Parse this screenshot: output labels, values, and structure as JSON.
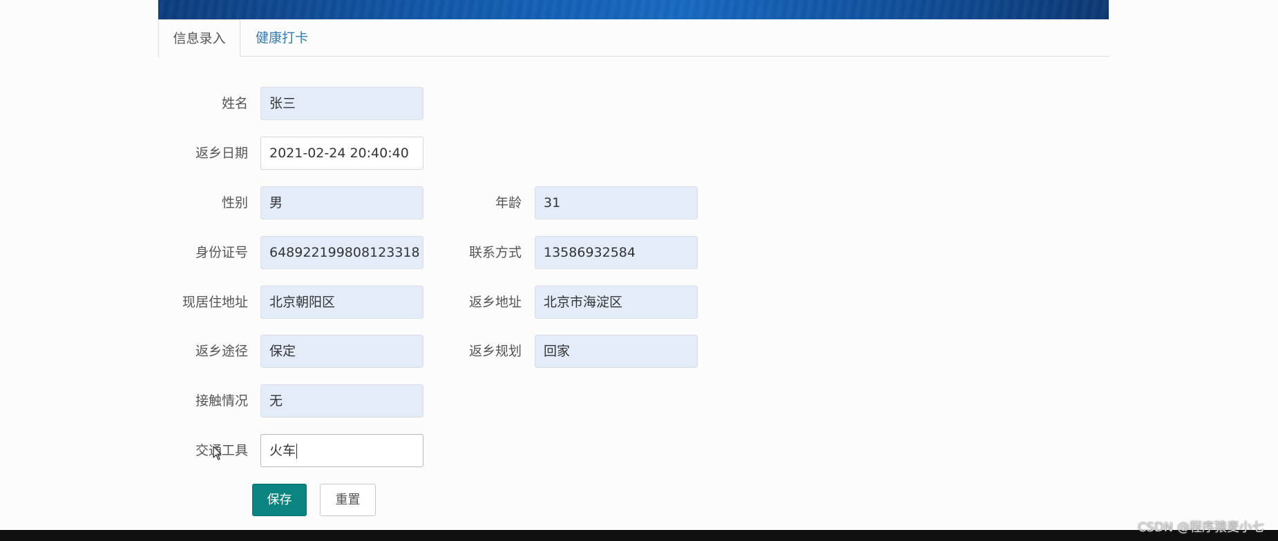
{
  "tabs": {
    "info_entry": "信息录入",
    "health_checkin": "健康打卡"
  },
  "form": {
    "name": {
      "label": "姓名",
      "value": "张三"
    },
    "return_date": {
      "label": "返乡日期",
      "value": "2021-02-24 20:40:40"
    },
    "gender": {
      "label": "性别",
      "value": "男"
    },
    "age": {
      "label": "年龄",
      "value": "31"
    },
    "id_number": {
      "label": "身份证号",
      "value": "648922199808123318"
    },
    "contact": {
      "label": "联系方式",
      "value": "13586932584"
    },
    "current_address": {
      "label": "现居住地址",
      "value": "北京朝阳区"
    },
    "return_address": {
      "label": "返乡地址",
      "value": "北京市海淀区"
    },
    "route": {
      "label": "返乡途径",
      "value": "保定"
    },
    "plan": {
      "label": "返乡规划",
      "value": "回家"
    },
    "contact_status": {
      "label": "接触情况",
      "value": "无"
    },
    "transport": {
      "label": "交通工具",
      "value": "火车"
    }
  },
  "buttons": {
    "save": "保存",
    "reset": "重置"
  },
  "watermark": "CSDN @程序猿麦小七",
  "colors": {
    "primary_button": "#0a8480",
    "field_fill": "#e3ecf8",
    "tab_link": "#337ab7"
  }
}
